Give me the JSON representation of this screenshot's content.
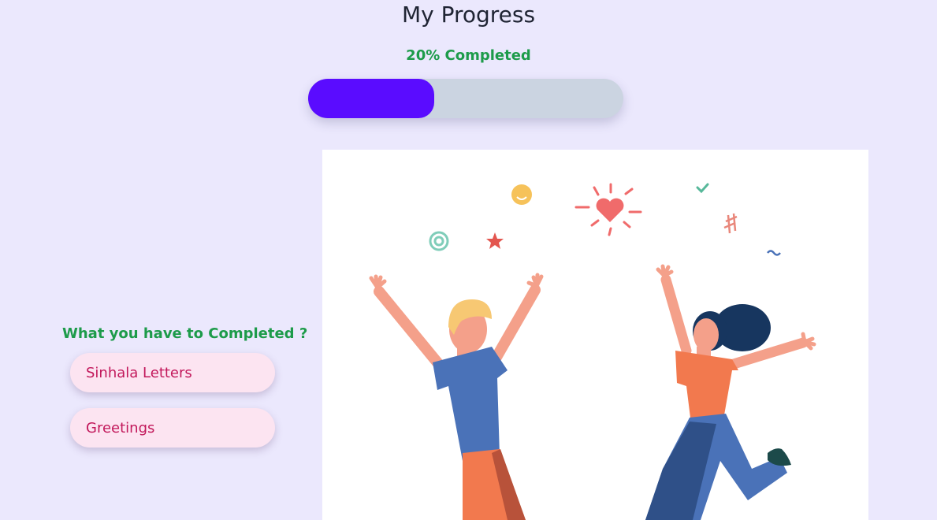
{
  "page": {
    "title": "My Progress",
    "progress_label": "20% Completed",
    "progress_fraction": 0.4
  },
  "tasks": {
    "heading": "What you have to Completed ?",
    "items": [
      {
        "label": "Sinhala Letters"
      },
      {
        "label": "Greetings"
      }
    ]
  },
  "illustration": {
    "icon": "celebrating-people-illustration"
  },
  "colors": {
    "background": "#ebe8fd",
    "accent_green": "#1d9b4a",
    "progress_fill": "#5a0cff",
    "progress_track": "#cbd4e1",
    "task_bg": "#fce4f1",
    "task_text": "#c2185b"
  }
}
